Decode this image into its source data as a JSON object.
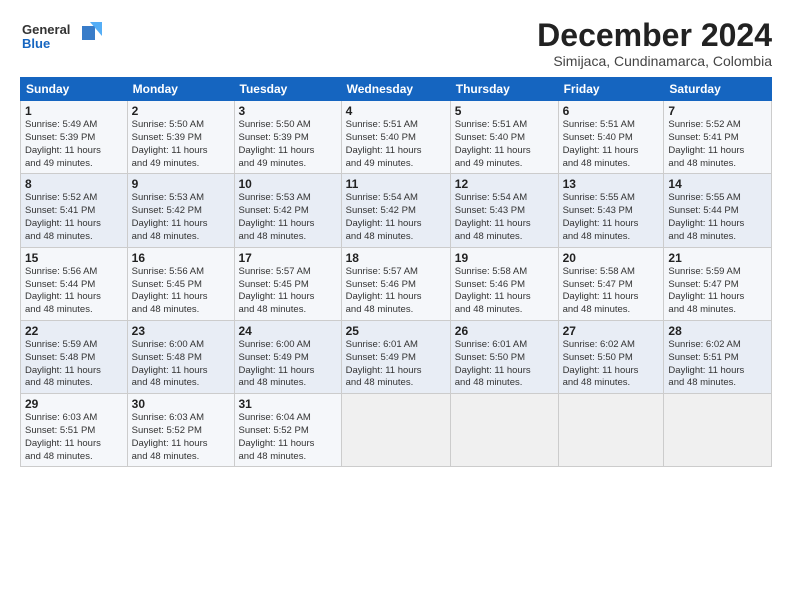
{
  "logo": {
    "line1": "General",
    "line2": "Blue"
  },
  "title": "December 2024",
  "subtitle": "Simijaca, Cundinamarca, Colombia",
  "columns": [
    "Sunday",
    "Monday",
    "Tuesday",
    "Wednesday",
    "Thursday",
    "Friday",
    "Saturday"
  ],
  "weeks": [
    [
      {
        "day": "1",
        "info": "Sunrise: 5:49 AM\nSunset: 5:39 PM\nDaylight: 11 hours\nand 49 minutes."
      },
      {
        "day": "2",
        "info": "Sunrise: 5:50 AM\nSunset: 5:39 PM\nDaylight: 11 hours\nand 49 minutes."
      },
      {
        "day": "3",
        "info": "Sunrise: 5:50 AM\nSunset: 5:39 PM\nDaylight: 11 hours\nand 49 minutes."
      },
      {
        "day": "4",
        "info": "Sunrise: 5:51 AM\nSunset: 5:40 PM\nDaylight: 11 hours\nand 49 minutes."
      },
      {
        "day": "5",
        "info": "Sunrise: 5:51 AM\nSunset: 5:40 PM\nDaylight: 11 hours\nand 49 minutes."
      },
      {
        "day": "6",
        "info": "Sunrise: 5:51 AM\nSunset: 5:40 PM\nDaylight: 11 hours\nand 48 minutes."
      },
      {
        "day": "7",
        "info": "Sunrise: 5:52 AM\nSunset: 5:41 PM\nDaylight: 11 hours\nand 48 minutes."
      }
    ],
    [
      {
        "day": "8",
        "info": "Sunrise: 5:52 AM\nSunset: 5:41 PM\nDaylight: 11 hours\nand 48 minutes."
      },
      {
        "day": "9",
        "info": "Sunrise: 5:53 AM\nSunset: 5:42 PM\nDaylight: 11 hours\nand 48 minutes."
      },
      {
        "day": "10",
        "info": "Sunrise: 5:53 AM\nSunset: 5:42 PM\nDaylight: 11 hours\nand 48 minutes."
      },
      {
        "day": "11",
        "info": "Sunrise: 5:54 AM\nSunset: 5:42 PM\nDaylight: 11 hours\nand 48 minutes."
      },
      {
        "day": "12",
        "info": "Sunrise: 5:54 AM\nSunset: 5:43 PM\nDaylight: 11 hours\nand 48 minutes."
      },
      {
        "day": "13",
        "info": "Sunrise: 5:55 AM\nSunset: 5:43 PM\nDaylight: 11 hours\nand 48 minutes."
      },
      {
        "day": "14",
        "info": "Sunrise: 5:55 AM\nSunset: 5:44 PM\nDaylight: 11 hours\nand 48 minutes."
      }
    ],
    [
      {
        "day": "15",
        "info": "Sunrise: 5:56 AM\nSunset: 5:44 PM\nDaylight: 11 hours\nand 48 minutes."
      },
      {
        "day": "16",
        "info": "Sunrise: 5:56 AM\nSunset: 5:45 PM\nDaylight: 11 hours\nand 48 minutes."
      },
      {
        "day": "17",
        "info": "Sunrise: 5:57 AM\nSunset: 5:45 PM\nDaylight: 11 hours\nand 48 minutes."
      },
      {
        "day": "18",
        "info": "Sunrise: 5:57 AM\nSunset: 5:46 PM\nDaylight: 11 hours\nand 48 minutes."
      },
      {
        "day": "19",
        "info": "Sunrise: 5:58 AM\nSunset: 5:46 PM\nDaylight: 11 hours\nand 48 minutes."
      },
      {
        "day": "20",
        "info": "Sunrise: 5:58 AM\nSunset: 5:47 PM\nDaylight: 11 hours\nand 48 minutes."
      },
      {
        "day": "21",
        "info": "Sunrise: 5:59 AM\nSunset: 5:47 PM\nDaylight: 11 hours\nand 48 minutes."
      }
    ],
    [
      {
        "day": "22",
        "info": "Sunrise: 5:59 AM\nSunset: 5:48 PM\nDaylight: 11 hours\nand 48 minutes."
      },
      {
        "day": "23",
        "info": "Sunrise: 6:00 AM\nSunset: 5:48 PM\nDaylight: 11 hours\nand 48 minutes."
      },
      {
        "day": "24",
        "info": "Sunrise: 6:00 AM\nSunset: 5:49 PM\nDaylight: 11 hours\nand 48 minutes."
      },
      {
        "day": "25",
        "info": "Sunrise: 6:01 AM\nSunset: 5:49 PM\nDaylight: 11 hours\nand 48 minutes."
      },
      {
        "day": "26",
        "info": "Sunrise: 6:01 AM\nSunset: 5:50 PM\nDaylight: 11 hours\nand 48 minutes."
      },
      {
        "day": "27",
        "info": "Sunrise: 6:02 AM\nSunset: 5:50 PM\nDaylight: 11 hours\nand 48 minutes."
      },
      {
        "day": "28",
        "info": "Sunrise: 6:02 AM\nSunset: 5:51 PM\nDaylight: 11 hours\nand 48 minutes."
      }
    ],
    [
      {
        "day": "29",
        "info": "Sunrise: 6:03 AM\nSunset: 5:51 PM\nDaylight: 11 hours\nand 48 minutes."
      },
      {
        "day": "30",
        "info": "Sunrise: 6:03 AM\nSunset: 5:52 PM\nDaylight: 11 hours\nand 48 minutes."
      },
      {
        "day": "31",
        "info": "Sunrise: 6:04 AM\nSunset: 5:52 PM\nDaylight: 11 hours\nand 48 minutes."
      },
      {
        "day": "",
        "info": ""
      },
      {
        "day": "",
        "info": ""
      },
      {
        "day": "",
        "info": ""
      },
      {
        "day": "",
        "info": ""
      }
    ]
  ]
}
